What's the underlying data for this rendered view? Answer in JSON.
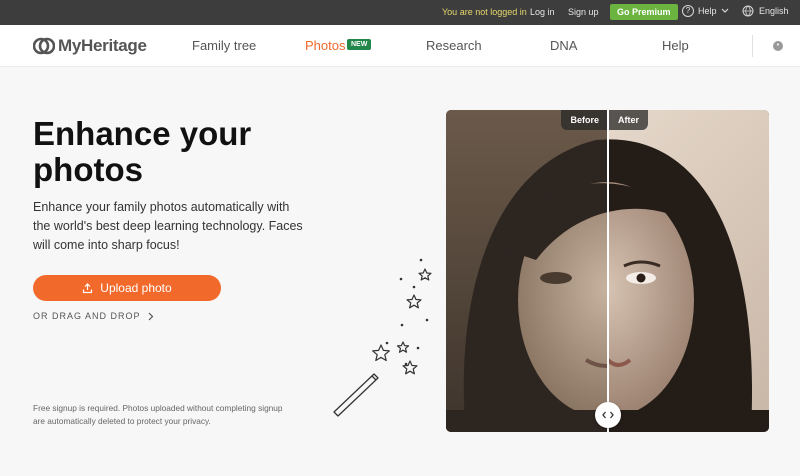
{
  "topbar": {
    "status": "You are not logged in",
    "login": "Log in",
    "signup": "Sign up",
    "premium": "Go Premium",
    "help": "Help",
    "language": "English"
  },
  "nav": {
    "logo": "MyHeritage",
    "items": [
      "Family tree",
      "Photos",
      "Research",
      "DNA",
      "Help"
    ],
    "new_badge": "NEW"
  },
  "hero": {
    "title": "Enhance your photos",
    "subtitle": "Enhance your family photos automatically with the world's best deep learning technology. Faces will come into sharp focus!",
    "upload_label": "Upload photo",
    "drag_label": "OR DRAG AND DROP",
    "disclaimer": "Free signup is required. Photos uploaded without completing signup are automatically deleted to protect your privacy."
  },
  "comparison": {
    "before_label": "Before",
    "after_label": "After"
  },
  "colors": {
    "accent_orange": "#f26a2b",
    "premium_green": "#6bb440",
    "new_badge_green": "#23874a",
    "topbar_bg": "#3d3d3d"
  }
}
